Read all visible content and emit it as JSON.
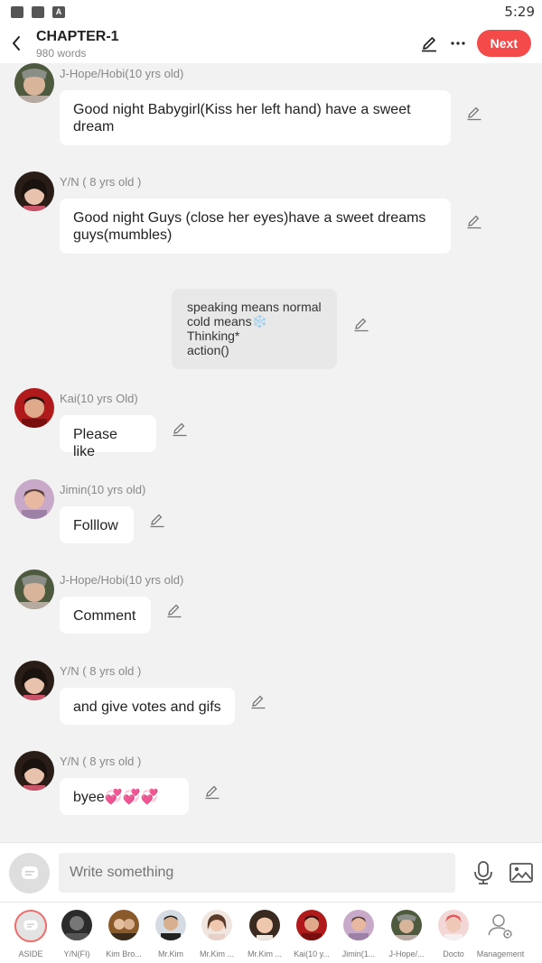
{
  "status": {
    "time": "5:29"
  },
  "header": {
    "title": "CHAPTER-1",
    "subtitle": "980 words",
    "next_label": "Next"
  },
  "messages": [
    {
      "speaker": "J-Hope/Hobi(10 yrs old)",
      "text": "Good night Babygirl(Kiss her left hand) have a sweet dream"
    },
    {
      "speaker": "Y/N ( 8 yrs old )",
      "text": "Good night Guys (close her eyes)have a sweet dreams guys(mumbles)"
    },
    {
      "speaker": "Kai(10 yrs Old)",
      "text": "Please like"
    },
    {
      "speaker": "Jimin(10 yrs old)",
      "text": "Folllow"
    },
    {
      "speaker": "J-Hope/Hobi(10 yrs old)",
      "text": "Comment"
    },
    {
      "speaker": "Y/N ( 8 yrs old )",
      "text": "and give votes and gifs"
    },
    {
      "speaker": "Y/N ( 8 yrs old )",
      "text": "byee💞💞💞"
    }
  ],
  "aside": {
    "lines": [
      "speaking means normal",
      "cold means❄️",
      "Thinking*",
      "action()"
    ]
  },
  "composer": {
    "placeholder": "Write something"
  },
  "cast": [
    {
      "label": "ASIDE"
    },
    {
      "label": "Y/N(FI)"
    },
    {
      "label": "Kim Bro..."
    },
    {
      "label": "Mr.Kim"
    },
    {
      "label": "Mr.Kim ..."
    },
    {
      "label": "Mr.Kim ..."
    },
    {
      "label": "Kai(10 y..."
    },
    {
      "label": "Jimin(1..."
    },
    {
      "label": "J-Hope/..."
    },
    {
      "label": "Docto"
    },
    {
      "label": "Management"
    }
  ],
  "colors": {
    "accent": "#f44a4a",
    "background": "#f2f2f2",
    "bubble": "#ffffff",
    "aside_bubble": "#e8e8e8"
  }
}
